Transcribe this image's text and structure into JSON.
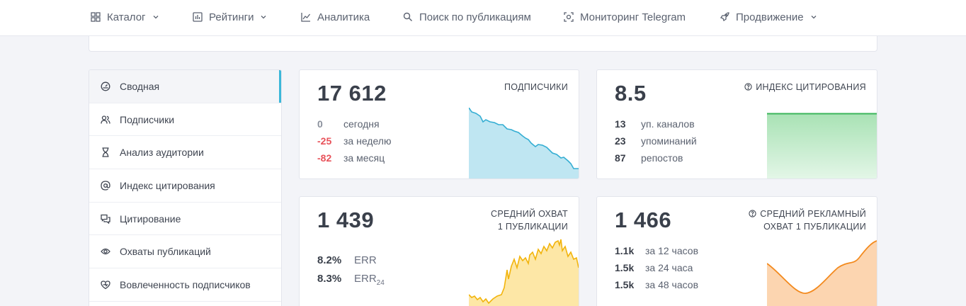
{
  "nav": {
    "items": [
      {
        "label": "Каталог",
        "icon": "grid-icon",
        "dropdown": true
      },
      {
        "label": "Рейтинги",
        "icon": "ratings-icon",
        "dropdown": true
      },
      {
        "label": "Аналитика",
        "icon": "analytics-icon",
        "dropdown": false
      },
      {
        "label": "Поиск по публикациям",
        "icon": "search-icon",
        "dropdown": false
      },
      {
        "label": "Мониторинг Telegram",
        "icon": "monitor-icon",
        "dropdown": false
      },
      {
        "label": "Продвижение",
        "icon": "rocket-icon",
        "dropdown": true
      }
    ]
  },
  "sidebar": {
    "items": [
      {
        "label": "Сводная",
        "icon": "dashboard-icon",
        "active": true
      },
      {
        "label": "Подписчики",
        "icon": "users-icon"
      },
      {
        "label": "Анализ аудитории",
        "icon": "hourglass-icon"
      },
      {
        "label": "Индекс цитирования",
        "icon": "at-icon"
      },
      {
        "label": "Цитирование",
        "icon": "quotes-icon"
      },
      {
        "label": "Охваты публикаций",
        "icon": "eye-icon"
      },
      {
        "label": "Вовлеченность подписчиков",
        "icon": "engagement-icon"
      }
    ]
  },
  "cards": {
    "subscribers": {
      "value": "17 612",
      "label": "ПОДПИСЧИКИ",
      "rows": [
        {
          "value": "0",
          "text": "сегодня",
          "color": "#8a909c"
        },
        {
          "value": "-25",
          "text": "за неделю",
          "color": "#e8525a"
        },
        {
          "value": "-82",
          "text": "за месяц",
          "color": "#e8525a"
        }
      ],
      "chart_color": "#35aed3",
      "chart_fill": "#bfe6f2"
    },
    "citation": {
      "value": "8.5",
      "label": "ИНДЕКС ЦИТИРОВАНИЯ",
      "icon": "help-circle-icon",
      "rows": [
        {
          "value": "13",
          "text": "уп. каналов"
        },
        {
          "value": "23",
          "text": "упоминаний"
        },
        {
          "value": "87",
          "text": "репостов"
        }
      ],
      "chart_color": "#3bb55a",
      "chart_fill": "#bfe9c7"
    },
    "reach": {
      "value": "1 439",
      "label_line1": "СРЕДНИЙ ОХВАТ",
      "label_line2": "1 ПУБЛИКАЦИИ",
      "err": [
        {
          "value": "8.2%",
          "text": "ERR",
          "sub": ""
        },
        {
          "value": "8.3%",
          "text": "ERR",
          "sub": "24"
        }
      ],
      "chart_color": "#f2b40c",
      "chart_fill": "#fde7a6"
    },
    "ad_reach": {
      "value": "1 466",
      "label_line1": "СРЕДНИЙ РЕКЛАМНЫЙ",
      "label_line2": "ОХВАТ 1 ПУБЛИКАЦИИ",
      "icon": "help-circle-icon",
      "rows": [
        {
          "value": "1.1k",
          "text": "за 12 часов"
        },
        {
          "value": "1.5k",
          "text": "за 24 часа"
        },
        {
          "value": "1.5k",
          "text": "за 48 часов"
        }
      ],
      "chart_color": "#f38a1e",
      "chart_fill": "#fcd5b0"
    }
  }
}
